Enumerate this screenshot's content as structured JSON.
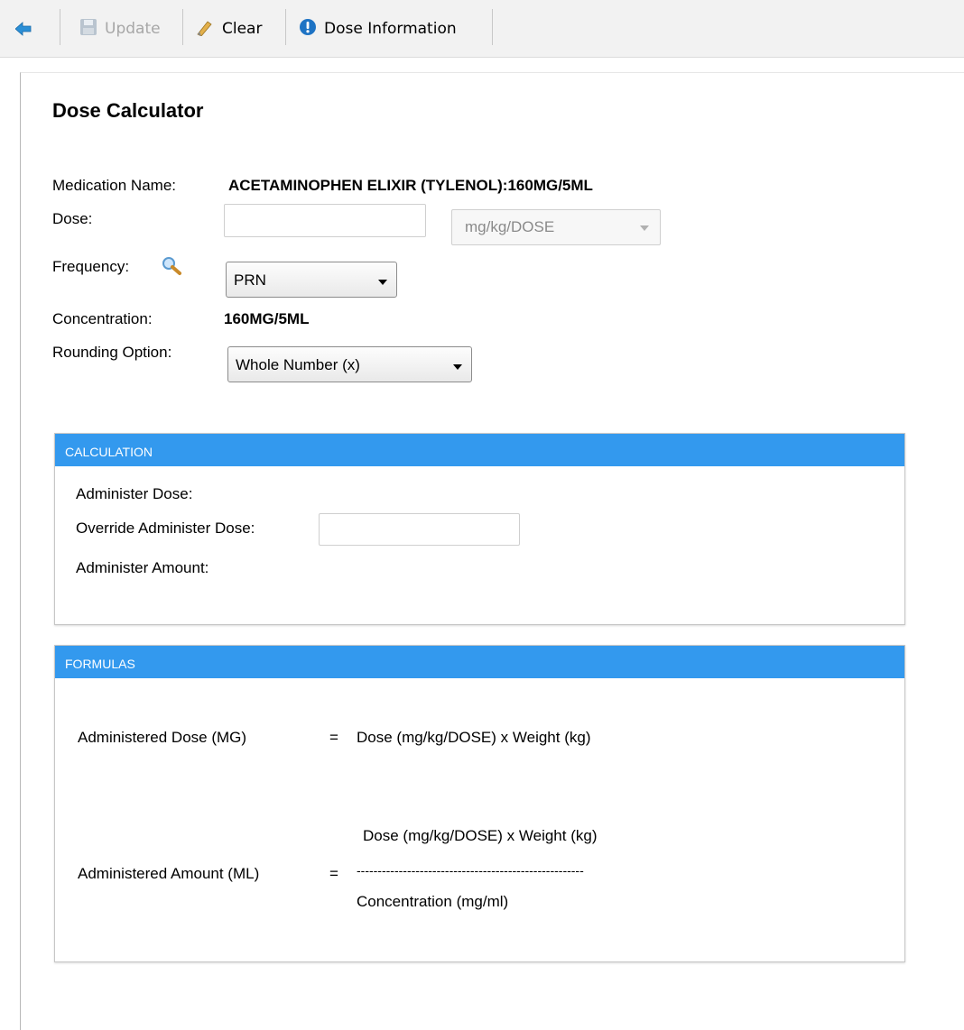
{
  "toolbar": {
    "update_label": "Update",
    "clear_label": "Clear",
    "dose_info_label": "Dose Information"
  },
  "page": {
    "title": "Dose Calculator"
  },
  "form": {
    "medication_label": "Medication Name:",
    "medication_value": "ACETAMINOPHEN ELIXIR (TYLENOL):160MG/5ML",
    "dose_label": "Dose:",
    "dose_value": "",
    "dose_unit_selected": "mg/kg/DOSE",
    "frequency_label": "Frequency:",
    "frequency_selected": "PRN",
    "concentration_label": "Concentration:",
    "concentration_value": "160MG/5ML",
    "rounding_label": "Rounding Option:",
    "rounding_selected": "Whole Number (x)"
  },
  "calculation": {
    "header": "CALCULATION",
    "administer_dose_label": "Administer Dose:",
    "override_label": "Override Administer Dose:",
    "override_value": "",
    "administer_amount_label": "Administer Amount:"
  },
  "formulas": {
    "header": "FORMULAS",
    "dose_formula_label": "Administered Dose (MG)",
    "equals": "=",
    "dose_formula_expr": "Dose (mg/kg/DOSE) x Weight (kg)",
    "amount_formula_label": "Administered Amount (ML)",
    "amount_numerator": "Dose (mg/kg/DOSE) x Weight (kg)",
    "amount_divider": "------------------------------------------------------",
    "amount_denominator": "Concentration (mg/ml)"
  },
  "icons": {
    "back": "arrow-left-icon",
    "update": "save-icon",
    "clear": "eraser-icon",
    "dose_info": "info-icon",
    "frequency_lookup": "magnifier-icon"
  },
  "colors": {
    "panel_header": "#3399ee",
    "back_arrow": "#2b8fd6"
  }
}
